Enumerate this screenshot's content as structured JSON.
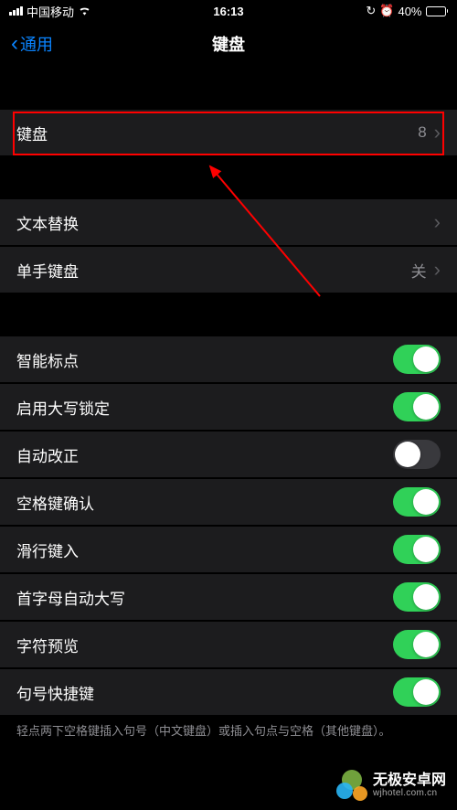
{
  "status": {
    "carrier": "中国移动",
    "time": "16:13",
    "battery_pct": "40%",
    "battery_fill_pct": 40
  },
  "nav": {
    "back_label": "通用",
    "title": "键盘"
  },
  "rows": {
    "keyboards": {
      "label": "键盘",
      "value": "8"
    },
    "text_replace": {
      "label": "文本替换"
    },
    "one_handed": {
      "label": "单手键盘",
      "value": "关"
    }
  },
  "toggles": {
    "smart_punct": {
      "label": "智能标点",
      "on": true
    },
    "caps_lock": {
      "label": "启用大写锁定",
      "on": true
    },
    "auto_correct": {
      "label": "自动改正",
      "on": false
    },
    "space_confirm": {
      "label": "空格键确认",
      "on": true
    },
    "slide_type": {
      "label": "滑行键入",
      "on": true
    },
    "auto_caps": {
      "label": "首字母自动大写",
      "on": true
    },
    "char_preview": {
      "label": "字符预览",
      "on": true
    },
    "period_shortcut": {
      "label": "句号快捷键",
      "on": true
    }
  },
  "footer_note": "轻点两下空格键插入句号（中文键盘）或插入句点与空格（其他键盘）。",
  "watermark": {
    "title": "无极安卓网",
    "url": "wjhotel.com.cn"
  }
}
